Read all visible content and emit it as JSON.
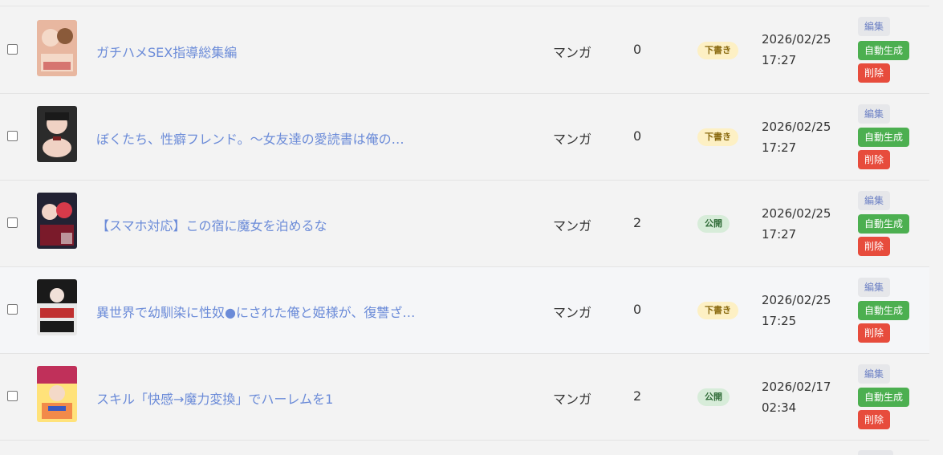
{
  "rows": [
    {
      "title": "ガチハメSEX指導総集編",
      "type": "マンガ",
      "count": "0",
      "status": "下書き",
      "status_kind": "draft",
      "date": "2026/02/25",
      "time": "17:27",
      "edit": "編集",
      "generate": "自動生成",
      "delete": "削除"
    },
    {
      "title": "ぼくたち、性癖フレンド。〜女友達の愛読書は俺の…",
      "type": "マンガ",
      "count": "0",
      "status": "下書き",
      "status_kind": "draft",
      "date": "2026/02/25",
      "time": "17:27",
      "edit": "編集",
      "generate": "自動生成",
      "delete": "削除"
    },
    {
      "title": "【スマホ対応】この宿に魔女を泊めるな",
      "type": "マンガ",
      "count": "2",
      "status": "公開",
      "status_kind": "pub",
      "date": "2026/02/25",
      "time": "17:27",
      "edit": "編集",
      "generate": "自動生成",
      "delete": "削除"
    },
    {
      "title": "異世界で幼馴染に性奴●にされた俺と姫様が、復讐ざ…",
      "type": "マンガ",
      "count": "0",
      "status": "下書き",
      "status_kind": "draft",
      "date": "2026/02/25",
      "time": "17:25",
      "edit": "編集",
      "generate": "自動生成",
      "delete": "削除"
    },
    {
      "title": "スキル「快感→魔力変換」でハーレムを1",
      "type": "マンガ",
      "count": "2",
      "status": "公開",
      "status_kind": "pub",
      "date": "2026/02/17",
      "time": "02:34",
      "edit": "編集",
      "generate": "自動生成",
      "delete": "削除"
    }
  ],
  "thumb_colors": [
    [
      "#e8b7a0",
      "#f4d9c8",
      "#c94a4a"
    ],
    [
      "#2b2b2b",
      "#f0d2c4",
      "#7a2222"
    ],
    [
      "#7a1a2a",
      "#d63a4a",
      "#222233"
    ],
    [
      "#1a1a1a",
      "#e8e8e8",
      "#c03030"
    ],
    [
      "#f28a4a",
      "#ffe27a",
      "#c0305a"
    ]
  ]
}
